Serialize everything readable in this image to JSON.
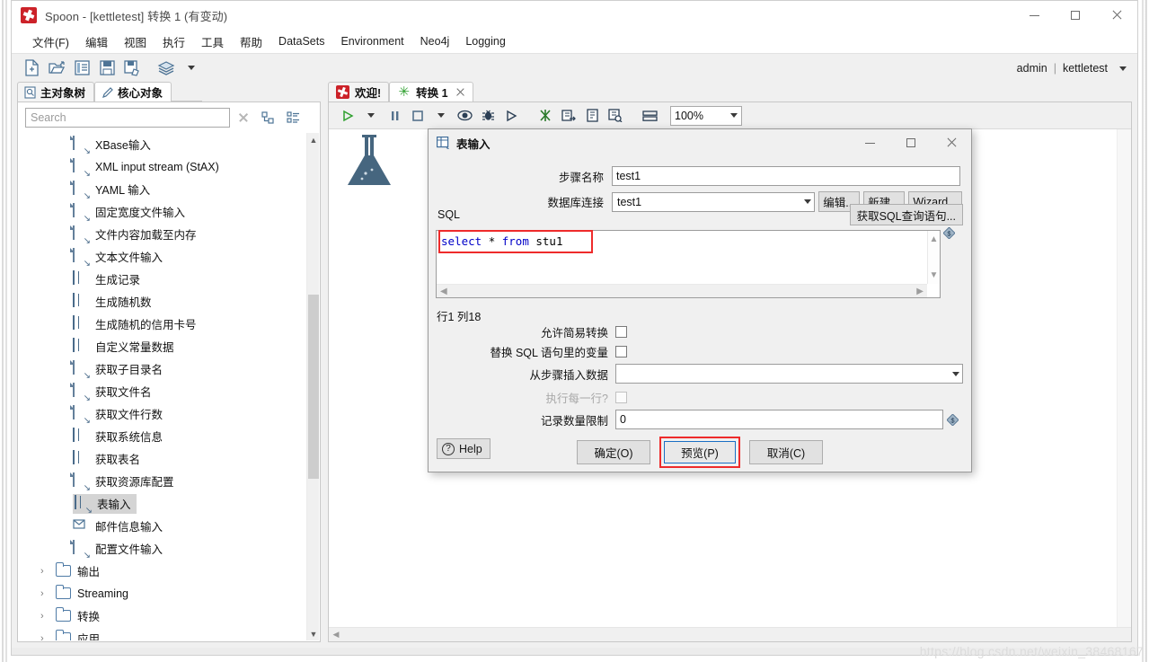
{
  "window": {
    "title": "Spoon - [kettletest] 转换 1 (有变动)",
    "app_icon": "spoon-logo-icon",
    "minimize": "—",
    "maximize": "□",
    "close": "✕"
  },
  "menu": {
    "items": [
      {
        "label": "文件(F)",
        "name": "menu-file"
      },
      {
        "label": "编辑",
        "name": "menu-edit"
      },
      {
        "label": "视图",
        "name": "menu-view"
      },
      {
        "label": "执行",
        "name": "menu-run"
      },
      {
        "label": "工具",
        "name": "menu-tools"
      },
      {
        "label": "帮助",
        "name": "menu-help"
      },
      {
        "label": "DataSets",
        "name": "menu-datasets"
      },
      {
        "label": "Environment",
        "name": "menu-environment"
      },
      {
        "label": "Neo4j",
        "name": "menu-neo4j"
      },
      {
        "label": "Logging",
        "name": "menu-logging"
      }
    ]
  },
  "toolbar": {
    "buttons": [
      {
        "name": "new-file-icon"
      },
      {
        "name": "open-file-icon"
      },
      {
        "name": "explore-repository-icon"
      },
      {
        "name": "save-icon"
      },
      {
        "name": "save-as-icon"
      },
      {
        "name": "layers-icon"
      },
      {
        "name": "layers-dropdown-caret-icon"
      }
    ],
    "user": "admin",
    "separator": "|",
    "repository": "kettletest",
    "user_caret": "caret-down-icon"
  },
  "left_panel": {
    "tabs": [
      {
        "label": "主对象树",
        "name": "tab-main-object-tree",
        "icon": "document-search-icon",
        "active": false
      },
      {
        "label": "核心对象",
        "name": "tab-core-objects",
        "icon": "pencil-icon",
        "active": true
      }
    ],
    "search": {
      "placeholder": "Search",
      "value": "",
      "clear_icon": "clear-x-icon",
      "expand_icon": "expand-tree-icon",
      "collapse_icon": "collapse-tree-icon"
    },
    "tree_items": [
      {
        "label": "XBase输入",
        "icon": "xbase-input-icon",
        "type": "step"
      },
      {
        "label": "XML input stream (StAX)",
        "icon": "xml-stax-input-icon",
        "type": "step"
      },
      {
        "label": "YAML 输入",
        "icon": "yaml-input-icon",
        "type": "step"
      },
      {
        "label": "固定宽度文件输入",
        "icon": "fixed-width-file-input-icon",
        "type": "step"
      },
      {
        "label": "文件内容加载至内存",
        "icon": "load-file-content-icon",
        "type": "step"
      },
      {
        "label": "文本文件输入",
        "icon": "text-file-input-icon",
        "type": "step"
      },
      {
        "label": "生成记录",
        "icon": "generate-rows-icon",
        "type": "step"
      },
      {
        "label": "生成随机数",
        "icon": "generate-random-value-icon",
        "type": "step"
      },
      {
        "label": "生成随机的信用卡号",
        "icon": "generate-random-creditcard-icon",
        "type": "step"
      },
      {
        "label": "自定义常量数据",
        "icon": "data-grid-icon",
        "type": "step"
      },
      {
        "label": "获取子目录名",
        "icon": "get-subfolder-names-icon",
        "type": "step"
      },
      {
        "label": "获取文件名",
        "icon": "get-file-names-icon",
        "type": "step"
      },
      {
        "label": "获取文件行数",
        "icon": "get-files-rowcount-icon",
        "type": "step"
      },
      {
        "label": "获取系统信息",
        "icon": "get-system-info-icon",
        "type": "step"
      },
      {
        "label": "获取表名",
        "icon": "get-table-names-icon",
        "type": "step"
      },
      {
        "label": "获取资源库配置",
        "icon": "get-repository-config-icon",
        "type": "step"
      },
      {
        "label": "表输入",
        "icon": "table-input-icon",
        "type": "step",
        "selected": true
      },
      {
        "label": "邮件信息输入",
        "icon": "mail-input-icon",
        "type": "step"
      },
      {
        "label": "配置文件输入",
        "icon": "property-input-icon",
        "type": "step"
      },
      {
        "label": "输出",
        "icon": "folder-icon",
        "type": "folder"
      },
      {
        "label": "Streaming",
        "icon": "folder-icon",
        "type": "folder"
      },
      {
        "label": "转换",
        "icon": "folder-icon",
        "type": "folder"
      },
      {
        "label": "应用",
        "icon": "folder-icon",
        "type": "folder"
      }
    ]
  },
  "right_panel": {
    "tabs": [
      {
        "label": "欢迎!",
        "name": "tab-welcome",
        "icon": "spoon-logo-icon",
        "active": false
      },
      {
        "label": "转换 1",
        "name": "tab-transformation-1",
        "icon": "transformation-icon",
        "active": true,
        "closable": true
      }
    ],
    "canvas_toolbar": {
      "buttons": [
        {
          "name": "run-icon",
          "glyph": "▷"
        },
        {
          "name": "run-dropdown-caret-icon",
          "glyph": "▾"
        },
        {
          "name": "pause-icon",
          "glyph": "‖"
        },
        {
          "name": "stop-icon",
          "glyph": "□"
        },
        {
          "name": "stop-dropdown-caret-icon",
          "glyph": "▾"
        },
        {
          "name": "preview-icon",
          "glyph": "◉"
        },
        {
          "name": "debug-icon",
          "glyph": "✹"
        },
        {
          "name": "replay-icon",
          "glyph": "▷"
        },
        {
          "name": "verify-icon",
          "glyph": "✳"
        },
        {
          "name": "impact-analysis-icon",
          "glyph": "⇨"
        },
        {
          "name": "generate-sql-icon",
          "glyph": "⎘"
        },
        {
          "name": "show-results-icon",
          "glyph": "⌕"
        },
        {
          "name": "arrange-icon",
          "glyph": "▤"
        }
      ],
      "zoom": "100%",
      "zoom_caret": "caret-down-icon"
    },
    "canvas_watermark_icon": "flask-icon"
  },
  "dialog": {
    "title": "表输入",
    "title_icon": "table-input-icon",
    "minimize": "—",
    "maximize": "□",
    "close": "✕",
    "step_name_label": "步骤名称",
    "step_name_value": "test1",
    "connection_label": "数据库连接",
    "connection_value": "test1",
    "connection_caret": "caret-down-icon",
    "edit_button": "编辑...",
    "new_button": "新建...",
    "wizard_button": "Wizard...",
    "sql_label": "SQL",
    "get_sql_button": "获取SQL查询语句...",
    "sql_tokens": [
      {
        "t": "select",
        "kw": true
      },
      {
        "t": " ",
        "kw": false
      },
      {
        "t": "*",
        "kw": false
      },
      {
        "t": " ",
        "kw": false
      },
      {
        "t": "from",
        "kw": true
      },
      {
        "t": " stu1",
        "kw": false
      }
    ],
    "sql_text": "select * from stu1",
    "sql_scroll_up": "scroll-up-icon",
    "sql_scroll_down": "scroll-down-icon",
    "sql_scroll_left": "scroll-left-icon",
    "sql_scroll_right": "scroll-right-icon",
    "sql_variable_icon": "variable-diamond-icon",
    "row_col_status": "行1 列18",
    "allow_lazy_label": "允许简易转换",
    "allow_lazy_checked": false,
    "replace_vars_label": "替换 SQL 语句里的变量",
    "replace_vars_checked": false,
    "insert_from_step_label": "从步骤插入数据",
    "insert_from_step_value": "",
    "insert_from_step_caret": "caret-down-icon",
    "execute_each_row_label": "执行每一行?",
    "execute_each_row_checked": false,
    "execute_each_row_disabled": true,
    "limit_label": "记录数量限制",
    "limit_value": "0",
    "limit_variable_icon": "variable-diamond-icon",
    "help_button": "Help",
    "help_icon": "question-circle-icon",
    "ok_button": "确定(O)",
    "preview_button": "预览(P)",
    "cancel_button": "取消(C)"
  },
  "watermark": "https://blog.csdn.net/weixin_38468167",
  "colors": {
    "accent_red": "#cc2229",
    "highlight_red": "#ee2b2b",
    "focus_blue": "#1a6fc4",
    "sql_keyword": "#0000c8",
    "tree_selection": "#d4d4d4"
  }
}
